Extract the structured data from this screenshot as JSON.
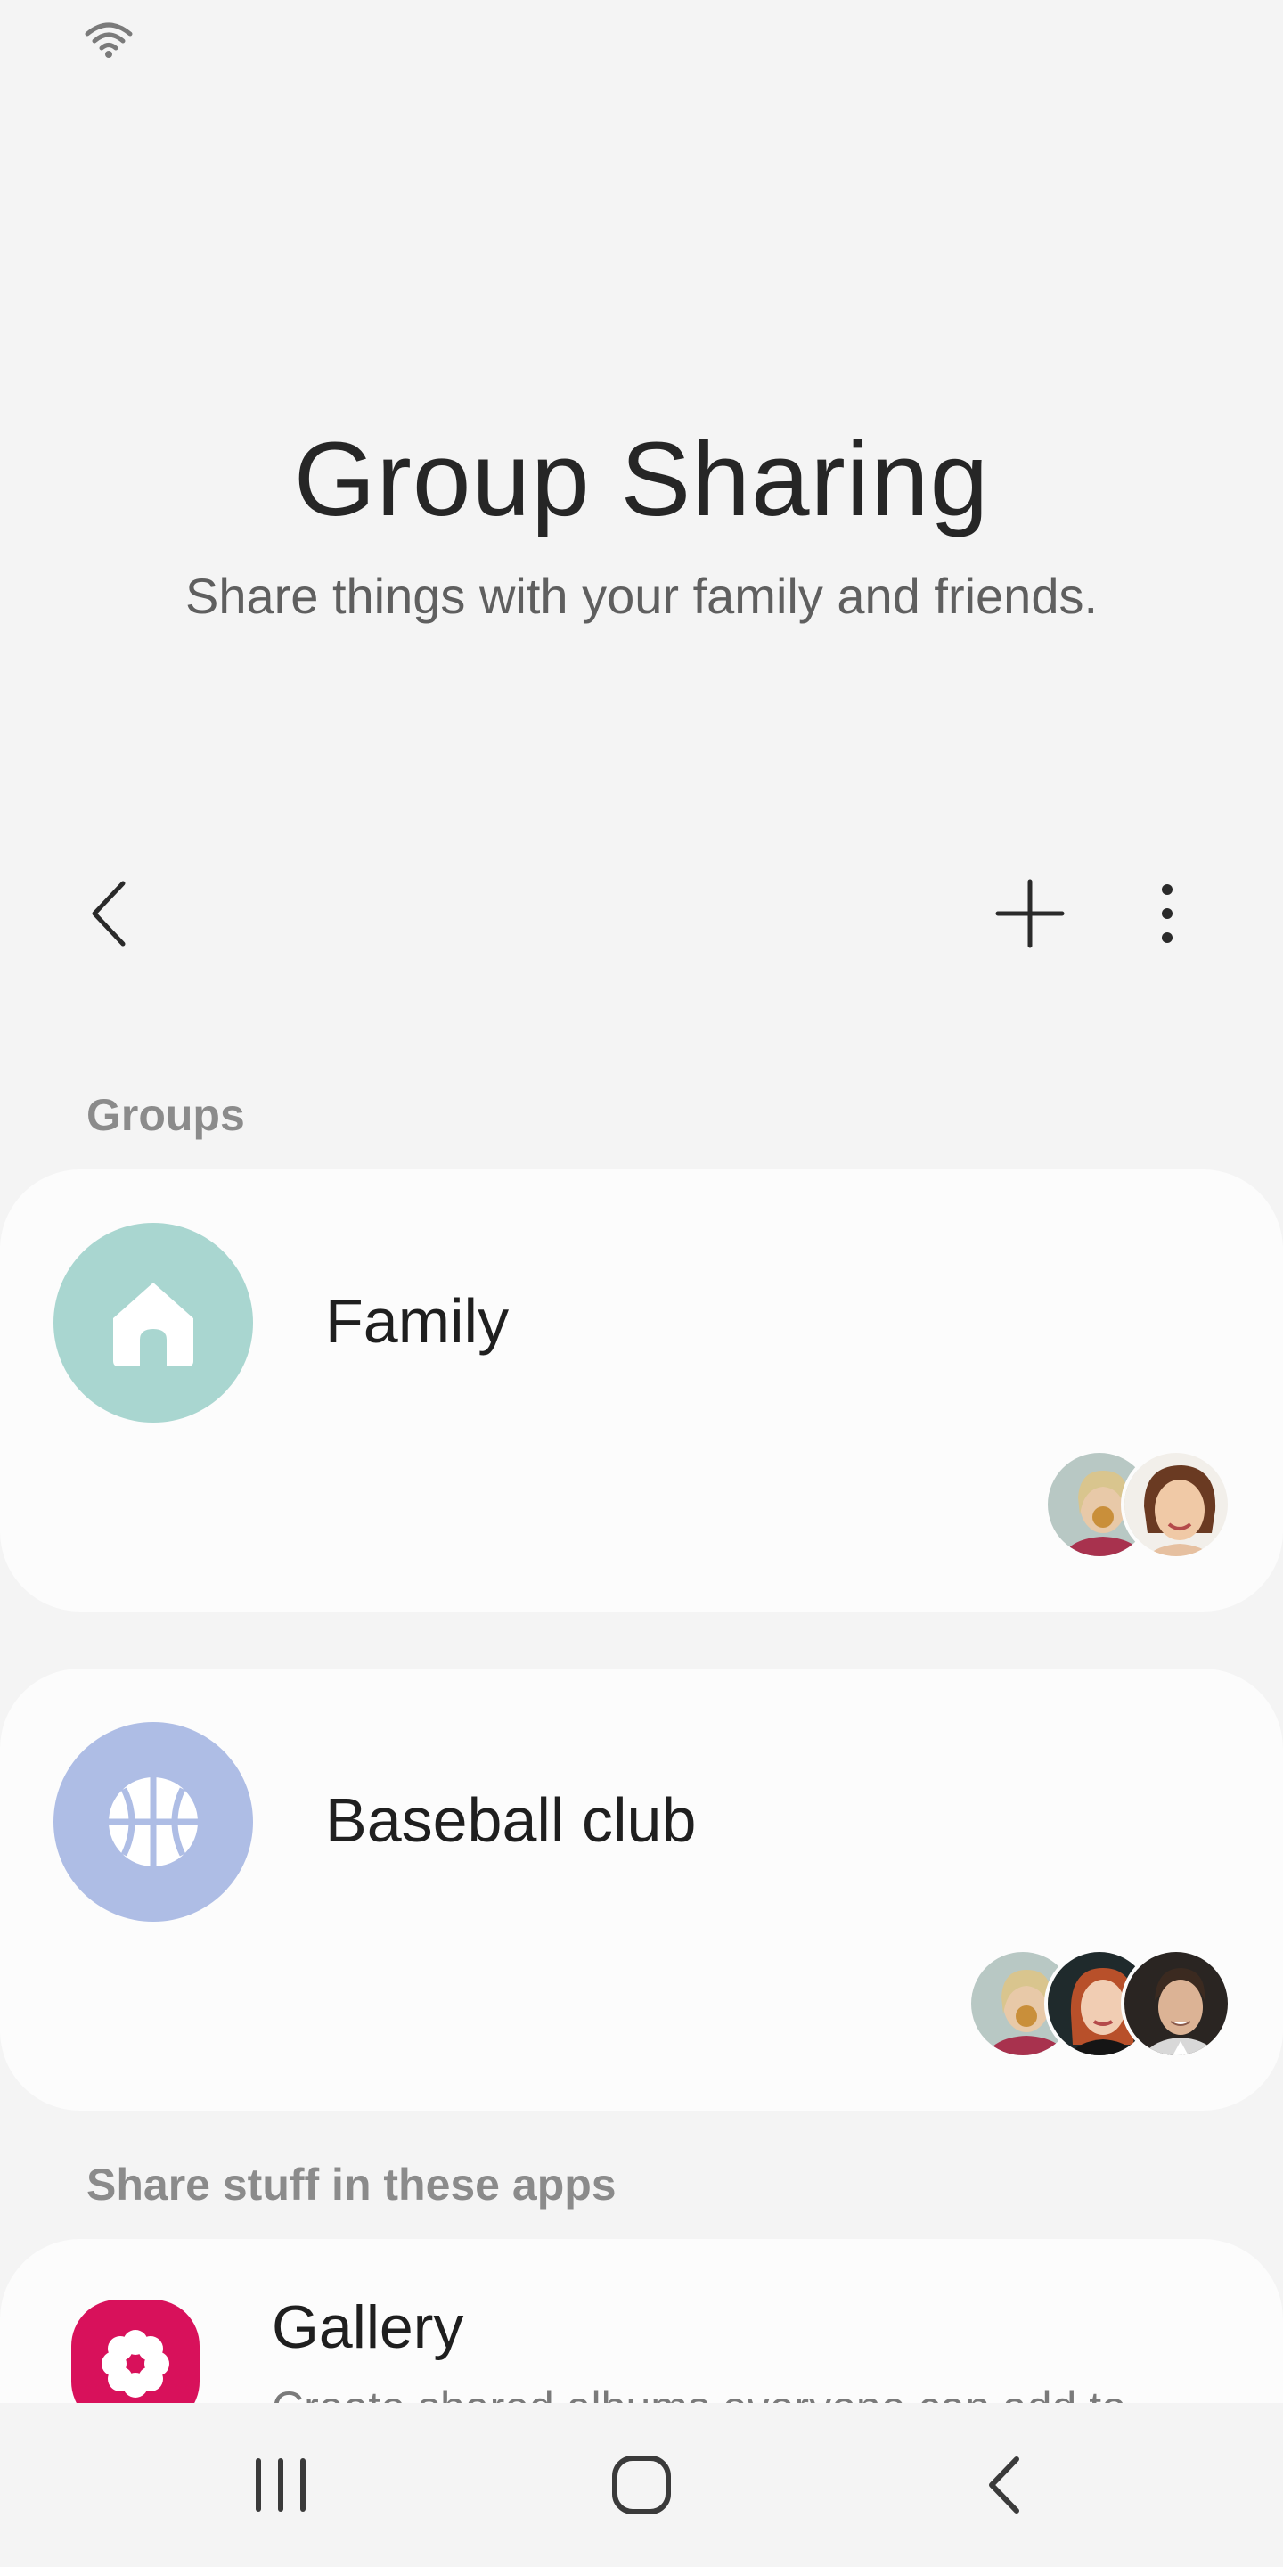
{
  "status_bar": {
    "wifi_icon": "wifi-icon"
  },
  "header": {
    "title": "Group Sharing",
    "subtitle": "Share things with your family and friends."
  },
  "toolbar": {
    "back_icon": "chevron-left-icon",
    "add_icon": "plus-icon",
    "more_icon": "more-vertical-icon"
  },
  "groups_section": {
    "label": "Groups",
    "groups": [
      {
        "name": "Family",
        "icon": "home-icon",
        "icon_color": "#a9d6d0",
        "member_count_shown": 2
      },
      {
        "name": "Baseball club",
        "icon": "basketball-icon",
        "icon_color": "#aebde5",
        "member_count_shown": 3
      }
    ]
  },
  "apps_section": {
    "label": "Share stuff in these apps",
    "apps": [
      {
        "name": "Gallery",
        "description": "Create shared albums everyone can add to.",
        "icon": "flower-icon",
        "icon_color": "#d8115b"
      }
    ]
  },
  "nav_bar": {
    "recents_icon": "recents-icon",
    "home_icon": "home-button-icon",
    "back_icon": "back-icon"
  }
}
